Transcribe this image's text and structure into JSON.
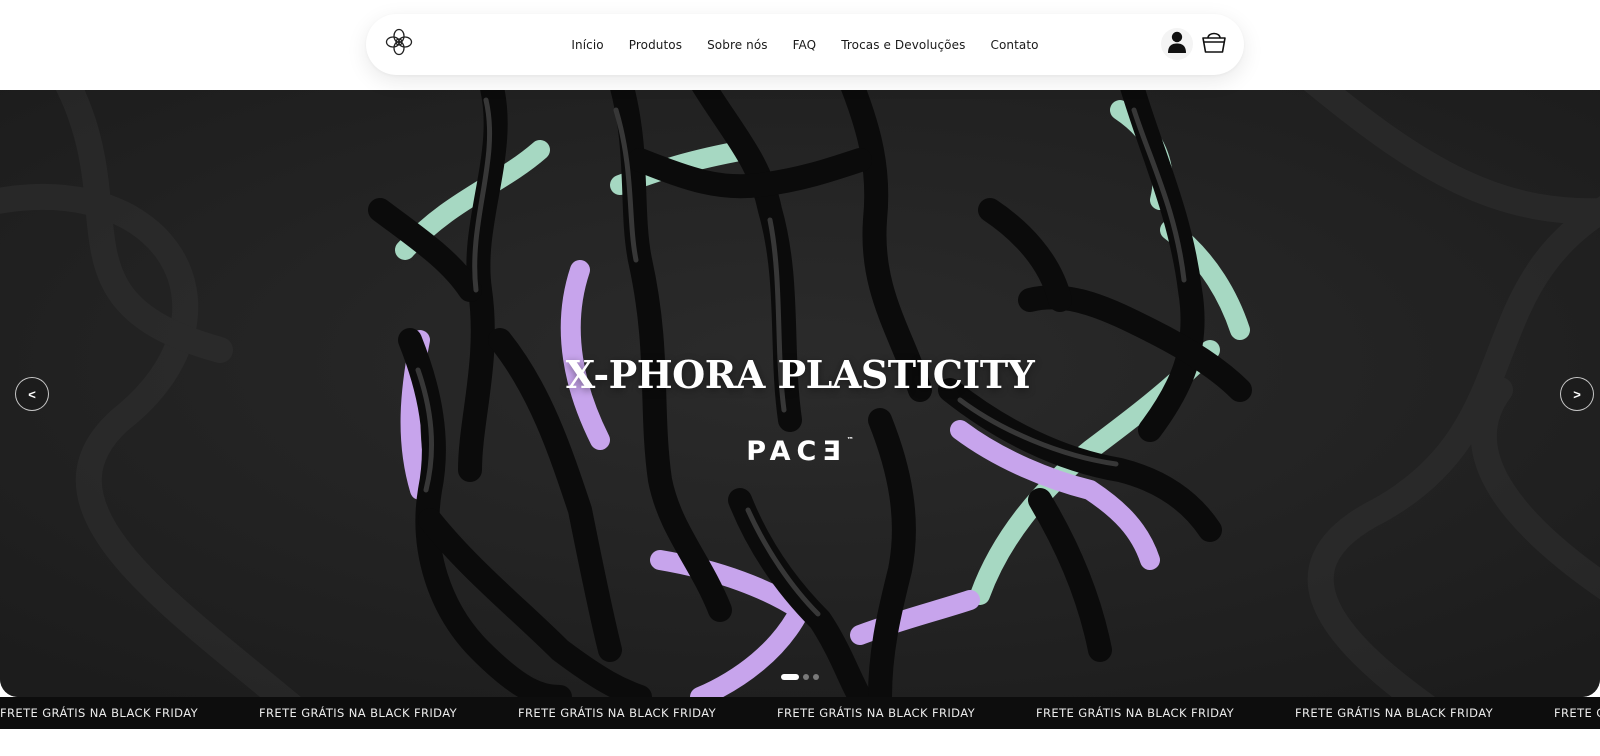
{
  "header": {
    "nav_items": [
      "Início",
      "Produtos",
      "Sobre nós",
      "FAQ",
      "Trocas e Devoluções",
      "Contato"
    ]
  },
  "hero": {
    "title": "X-PHORA PLASTICITY",
    "brand": "PACƎ",
    "brand_mark": "™",
    "prev_label": "<",
    "next_label": ">",
    "slide_count": 3,
    "active_slide": 1
  },
  "ticker": {
    "items": [
      "FRETE GRÁTIS NA BLACK FRIDAY",
      "FRETE GRÁTIS NA BLACK FRIDAY",
      "FRETE GRÁTIS NA BLACK FRIDAY",
      "FRETE GRÁTIS NA BLACK FRIDAY",
      "FRETE GRÁTIS NA BLACK FRIDAY",
      "FRETE GRÁTIS NA BLACK FRIDAY",
      "FRETE GRÁTIS NA BLACK FRIDAY"
    ]
  },
  "colors": {
    "hero_background": "#262626",
    "ticker_background": "#0d0d0d",
    "accent_mint": "#a6d8c2",
    "accent_lilac": "#c7a4ec"
  },
  "icons": {
    "logo": "flower-knot-logo",
    "account": "user-icon",
    "cart": "shopping-bag-icon"
  }
}
